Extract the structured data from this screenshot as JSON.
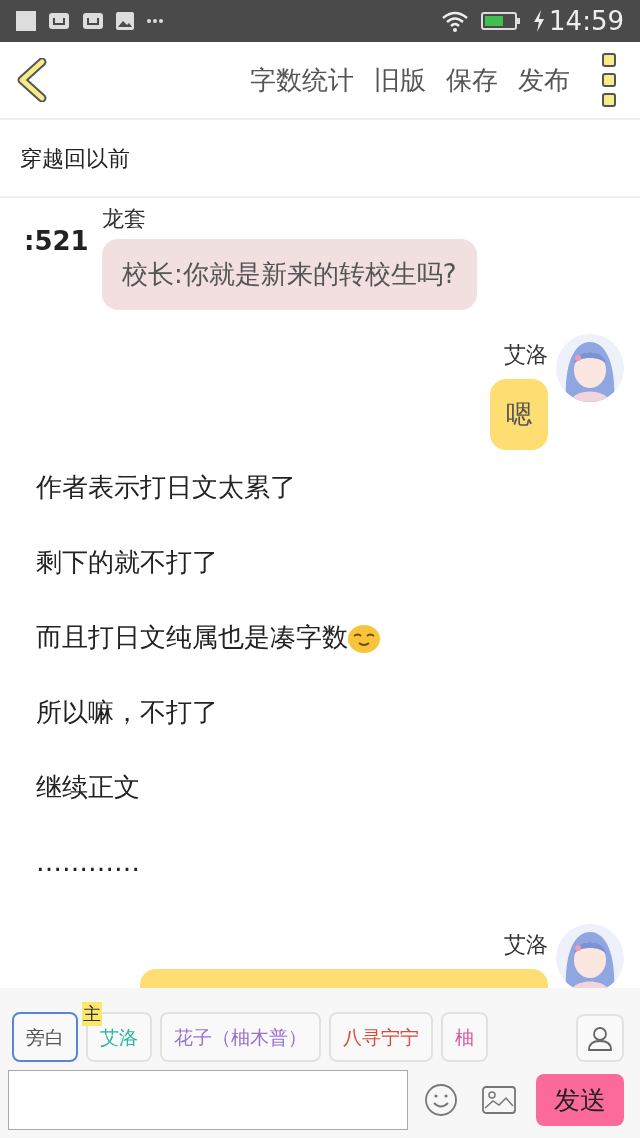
{
  "status_bar": {
    "time": "14:59"
  },
  "toolbar": {
    "actions": [
      "字数统计",
      "旧版",
      "保存",
      "发布"
    ]
  },
  "chapter_title": "穿越回以前",
  "messages": [
    {
      "kind": "left",
      "side_label": ":521",
      "speaker": "龙套",
      "text": "校长:你就是新来的转校生吗?"
    },
    {
      "kind": "right",
      "speaker": "艾洛",
      "text": "嗯"
    },
    {
      "kind": "narration",
      "text": "作者表示打日文太累了"
    },
    {
      "kind": "narration",
      "text": "剩下的就不打了"
    },
    {
      "kind": "narration",
      "text": "而且打日文纯属也是凑字数",
      "emoji": true
    },
    {
      "kind": "narration",
      "text": "所以嘛，不打了"
    },
    {
      "kind": "narration",
      "text": "继续正文"
    },
    {
      "kind": "narration",
      "text": "…………"
    },
    {
      "kind": "right",
      "speaker": "艾洛",
      "covered": true
    }
  ],
  "characters": [
    {
      "name": "旁白",
      "selected": true,
      "color": "#555555"
    },
    {
      "name": "艾洛",
      "selected": false,
      "color": "#2bb5a0",
      "badge": "主"
    },
    {
      "name": "花子（柚木普）",
      "selected": false,
      "color": "#9b6fd0"
    },
    {
      "name": "八寻宁宁",
      "selected": false,
      "color": "#d84a3a"
    },
    {
      "name": "柚",
      "selected": false,
      "color": "#e0569a"
    }
  ],
  "composer": {
    "send": "发送"
  }
}
